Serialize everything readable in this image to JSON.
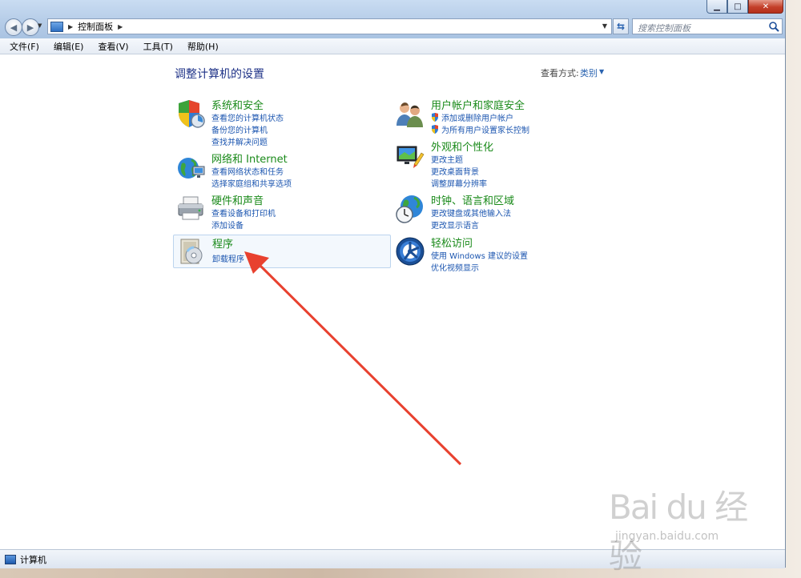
{
  "window": {
    "breadcrumb": [
      "控制面板"
    ],
    "search_placeholder": "搜索控制面板",
    "min_glyph": "▁",
    "max_glyph": "□",
    "close_glyph": "✕"
  },
  "menu": [
    "文件(F)",
    "编辑(E)",
    "查看(V)",
    "工具(T)",
    "帮助(H)"
  ],
  "main": {
    "title": "调整计算机的设置",
    "view_by_label": "查看方式:",
    "view_by_value": "类别"
  },
  "categories": [
    {
      "title": "系统和安全",
      "icon": "shield-icon",
      "links": [
        "查看您的计算机状态",
        "备份您的计算机",
        "查找并解决问题"
      ]
    },
    {
      "title": "网络和 Internet",
      "icon": "network-globe-icon",
      "links": [
        "查看网络状态和任务",
        "选择家庭组和共享选项"
      ]
    },
    {
      "title": "硬件和声音",
      "icon": "printer-icon",
      "links": [
        "查看设备和打印机",
        "添加设备"
      ]
    },
    {
      "title": "程序",
      "icon": "programs-icon",
      "links": [
        "卸载程序"
      ]
    },
    {
      "title": "用户帐户和家庭安全",
      "icon": "users-icon",
      "links": [
        "添加或删除用户帐户",
        "为所有用户设置家长控制"
      ]
    },
    {
      "title": "外观和个性化",
      "icon": "monitor-paint-icon",
      "links": [
        "更改主题",
        "更改桌面背景",
        "调整屏幕分辨率"
      ]
    },
    {
      "title": "时钟、语言和区域",
      "icon": "clock-globe-icon",
      "links": [
        "更改键盘或其他输入法",
        "更改显示语言"
      ]
    },
    {
      "title": "轻松访问",
      "icon": "ease-of-access-icon",
      "links": [
        "使用 Windows 建议的设置",
        "优化视频显示"
      ]
    }
  ],
  "status": {
    "text": "计算机"
  },
  "watermark": {
    "logo": "Bai du 经验",
    "url": "jingyan.baidu.com"
  },
  "colors": {
    "title_green": "#1a8a1a",
    "link_blue": "#1c56b0",
    "heading_blue": "#1e3287",
    "arrow_red": "#e8412f"
  }
}
